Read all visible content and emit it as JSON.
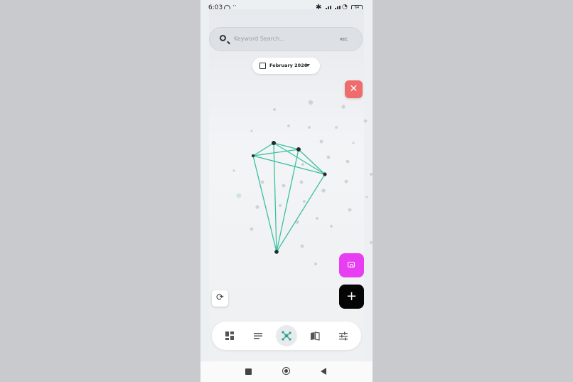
{
  "status": {
    "time": "6:03",
    "extra": "··",
    "bluetooth": "✱",
    "wifi": "◔",
    "battery": "64"
  },
  "search": {
    "placeholder": "Keyword Search...",
    "tag": "REC"
  },
  "date": {
    "label": "February 2026"
  },
  "buttons": {
    "close": "✕",
    "add": "+",
    "refresh": "⟳"
  },
  "nav": {
    "items": [
      {
        "icon": "dashboard-icon"
      },
      {
        "icon": "list-icon"
      },
      {
        "icon": "network-graph-icon",
        "active": true
      },
      {
        "icon": "book-icon"
      },
      {
        "icon": "sliders-icon"
      }
    ]
  },
  "colors": {
    "accent": "#3cc0a2",
    "close": "#ef6c6c",
    "camera": "#e63ef0",
    "add": "#050505"
  }
}
